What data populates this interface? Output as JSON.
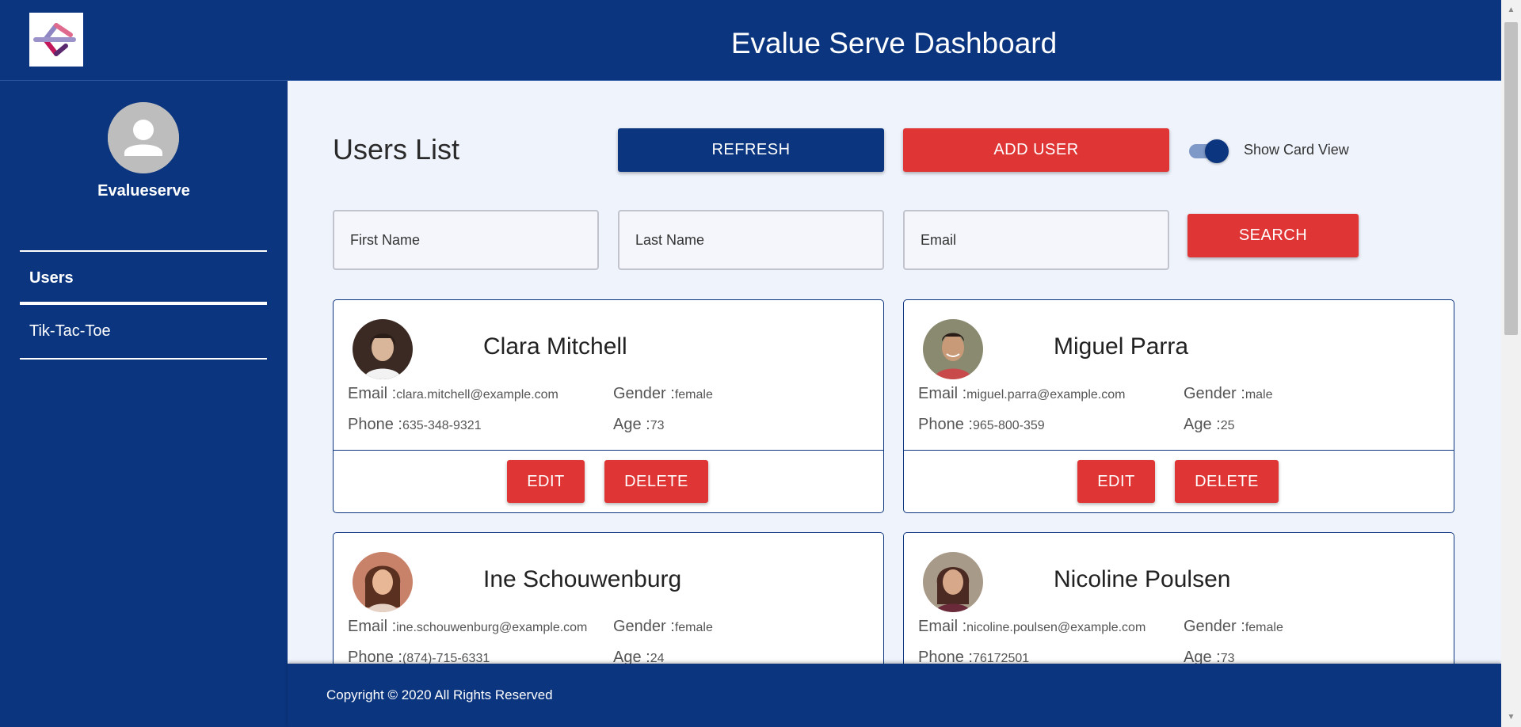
{
  "header": {
    "title": "Evalue Serve Dashboard",
    "logo_icon": "evalueserve-logo-icon"
  },
  "sidebar": {
    "username": "Evalueserve",
    "avatar_icon": "user-avatar-icon",
    "items": [
      {
        "label": "Users",
        "active": true
      },
      {
        "label": "Tik-Tac-Toe",
        "active": false
      }
    ]
  },
  "main": {
    "title": "Users List",
    "refresh_label": "REFRESH",
    "add_user_label": "ADD USER",
    "toggle_label": "Show Card View",
    "toggle_on": true,
    "search_label": "SEARCH",
    "fields": {
      "first_name_placeholder": "First Name",
      "last_name_placeholder": "Last Name",
      "email_placeholder": "Email"
    }
  },
  "card_labels": {
    "email": "Email :",
    "gender": "Gender :",
    "phone": "Phone :",
    "age": "Age :",
    "edit": "EDIT",
    "delete": "DELETE"
  },
  "users": [
    {
      "name": "Clara Mitchell",
      "email": "clara.mitchell@example.com",
      "gender": "female",
      "phone": "635-348-9321",
      "age": "73"
    },
    {
      "name": "Miguel Parra",
      "email": "miguel.parra@example.com",
      "gender": "male",
      "phone": "965-800-359",
      "age": "25"
    },
    {
      "name": "Ine Schouwenburg",
      "email": "ine.schouwenburg@example.com",
      "gender": "female",
      "phone": "(874)-715-6331",
      "age": "24"
    },
    {
      "name": "Nicoline Poulsen",
      "email": "nicoline.poulsen@example.com",
      "gender": "female",
      "phone": "76172501",
      "age": "73"
    }
  ],
  "footer": {
    "copyright": "Copyright © 2020 All Rights Reserved"
  },
  "colors": {
    "primary": "#0b357f",
    "accent": "#e03535",
    "background": "#eff3fc"
  }
}
